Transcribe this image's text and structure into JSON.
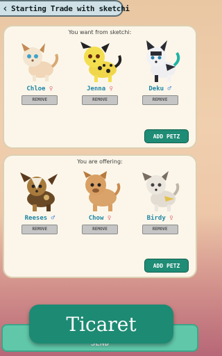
{
  "header": {
    "back_icon": "chevron-left-icon",
    "title": "Starting Trade with sketchi"
  },
  "want": {
    "heading": "You want from sketchi:",
    "pets": [
      {
        "name": "Chloe",
        "gender": "female",
        "symbol": "♀"
      },
      {
        "name": "Jenna",
        "gender": "female",
        "symbol": "♀"
      },
      {
        "name": "Deku",
        "gender": "male",
        "symbol": "♂"
      }
    ],
    "remove_label": "REMOVE",
    "add_label": "ADD PETZ"
  },
  "offer": {
    "heading": "You are offering:",
    "pets": [
      {
        "name": "Reeses",
        "gender": "male",
        "symbol": "♂"
      },
      {
        "name": "Chow",
        "gender": "female",
        "symbol": "♀"
      },
      {
        "name": "Birdy",
        "gender": "female",
        "symbol": "♀"
      }
    ],
    "remove_label": "REMOVE",
    "add_label": "ADD PETZ"
  },
  "footer": {
    "send_label": "SEND",
    "banner_text": "Ticaret"
  },
  "colors": {
    "accent": "#1f8c76",
    "name": "#1e86a6",
    "female": "#e26d7d",
    "male": "#3c7fd8"
  }
}
